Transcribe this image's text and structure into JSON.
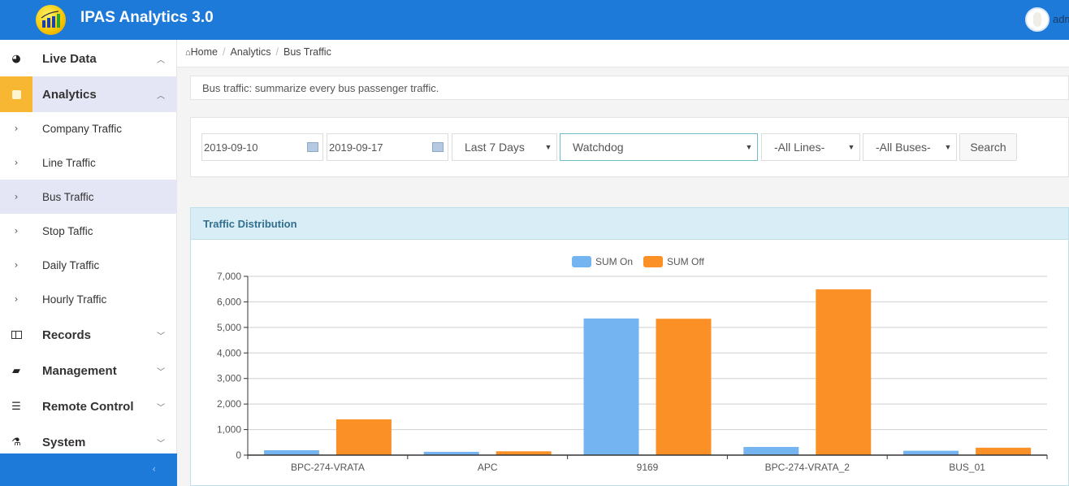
{
  "header": {
    "app_title": "IPAS Analytics 3.0",
    "user_name": "admin",
    "logo_icon": "bar-chart-growth-icon",
    "avatar_icon": "user-avatar-icon"
  },
  "sidebar": {
    "groups": [
      {
        "label": "Live Data",
        "icon": "dashboard-icon",
        "chevron": "^"
      },
      {
        "label": "Analytics",
        "icon": "edit-icon",
        "chevron": "^",
        "active": true
      },
      {
        "label": "Records",
        "icon": "columns-icon",
        "chevron": "v"
      },
      {
        "label": "Management",
        "icon": "book-icon",
        "chevron": "v"
      },
      {
        "label": "Remote Control",
        "icon": "list-icon",
        "chevron": "v"
      },
      {
        "label": "System",
        "icon": "flask-icon",
        "chevron": "v"
      }
    ],
    "analytics_items": [
      {
        "label": "Company Traffic"
      },
      {
        "label": "Line Traffic"
      },
      {
        "label": "Bus Traffic",
        "active": true
      },
      {
        "label": "Stop Taffic"
      },
      {
        "label": "Daily Traffic"
      },
      {
        "label": "Hourly Traffic"
      }
    ],
    "collapse_glyph": "‹"
  },
  "breadcrumb": {
    "home": "Home",
    "items": [
      "Analytics",
      "Bus Traffic"
    ],
    "separator": "/"
  },
  "description": "Bus traffic: summarize every bus passenger traffic.",
  "filters": {
    "start_date": "2019-09-10",
    "end_date": "2019-09-17",
    "range": "Last 7 Days",
    "company": "Watchdog",
    "line": "-All Lines-",
    "bus": "-All Buses-",
    "search_label": "Search"
  },
  "panel": {
    "title": "Traffic Distribution"
  },
  "chart_data": {
    "type": "bar",
    "title": "",
    "xlabel": "",
    "ylabel": "",
    "categories": [
      "BPC-274-VRATA",
      "APC",
      "9169",
      "BPC-274-VRATA_2",
      "BUS_01"
    ],
    "series": [
      {
        "name": "SUM On",
        "color": "#74b4f0",
        "values": [
          190,
          130,
          5350,
          320,
          170
        ]
      },
      {
        "name": "SUM Off",
        "color": "#fb9126",
        "values": [
          1400,
          150,
          5340,
          6490,
          290
        ]
      }
    ],
    "ylim": [
      0,
      7000
    ],
    "yticks": [
      0,
      1000,
      2000,
      3000,
      4000,
      5000,
      6000,
      7000
    ],
    "ytick_labels": [
      "0",
      "1,000",
      "2,000",
      "3,000",
      "4,000",
      "5,000",
      "6,000",
      "7,000"
    ],
    "grid": true,
    "legend": "top-center"
  }
}
